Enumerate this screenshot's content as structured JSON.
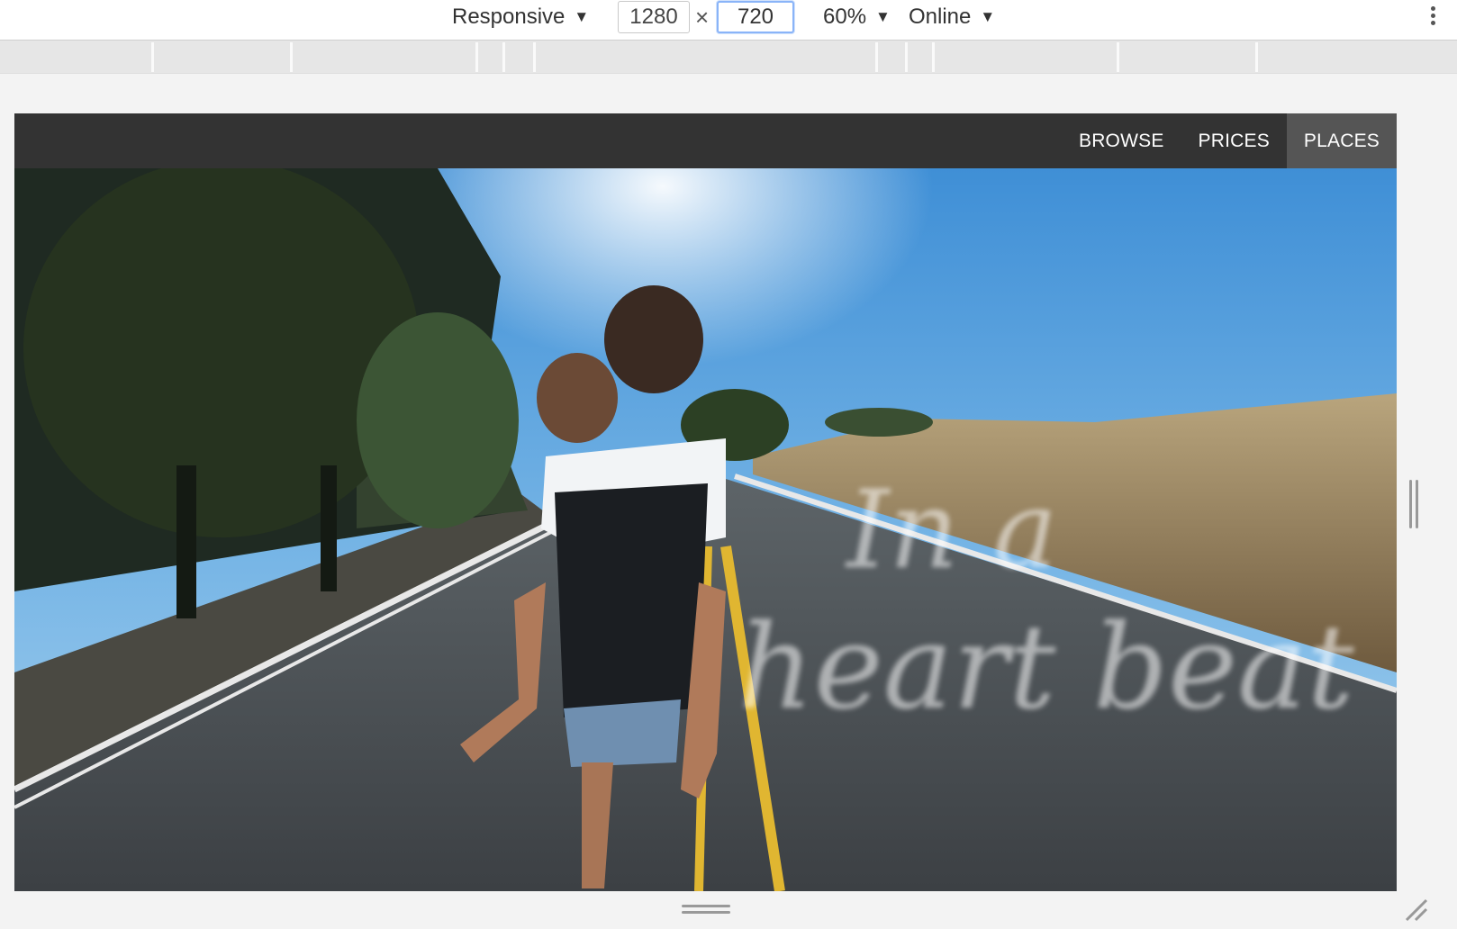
{
  "toolbar": {
    "device_label": "Responsive",
    "width_value": "1280",
    "times_symbol": "×",
    "height_value": "720",
    "zoom_label": "60%",
    "network_label": "Online",
    "caret": "▼"
  },
  "site": {
    "nav": {
      "browse": "BROWSE",
      "prices": "PRICES",
      "places": "PLACES",
      "active": "places"
    },
    "hero": {
      "overlay_text_line1": "In a",
      "overlay_text_line2": "heart beat"
    }
  },
  "colors": {
    "navbar_bg": "#333333",
    "nav_active_bg": "#555555",
    "toolbar_bg": "#ffffff",
    "ruler_bg": "#e6e6e6",
    "input_focus": "#8ab4f8"
  },
  "icons": {
    "more": "kebab-menu-icon",
    "dropdown": "caret-down-icon",
    "resize": "resize-handle-icon"
  }
}
